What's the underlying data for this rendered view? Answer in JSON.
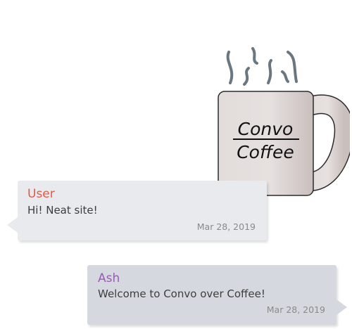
{
  "logo": {
    "line1": "Convo",
    "line2": "Coffee"
  },
  "messages": [
    {
      "author": "User",
      "text": "Hi! Neat site!",
      "timestamp": "Mar 28, 2019",
      "author_color": "#e05b46"
    },
    {
      "author": "Ash",
      "text": "Welcome to Convo over Coffee!",
      "timestamp": "Mar 28, 2019",
      "author_color": "#9b59b6"
    }
  ]
}
